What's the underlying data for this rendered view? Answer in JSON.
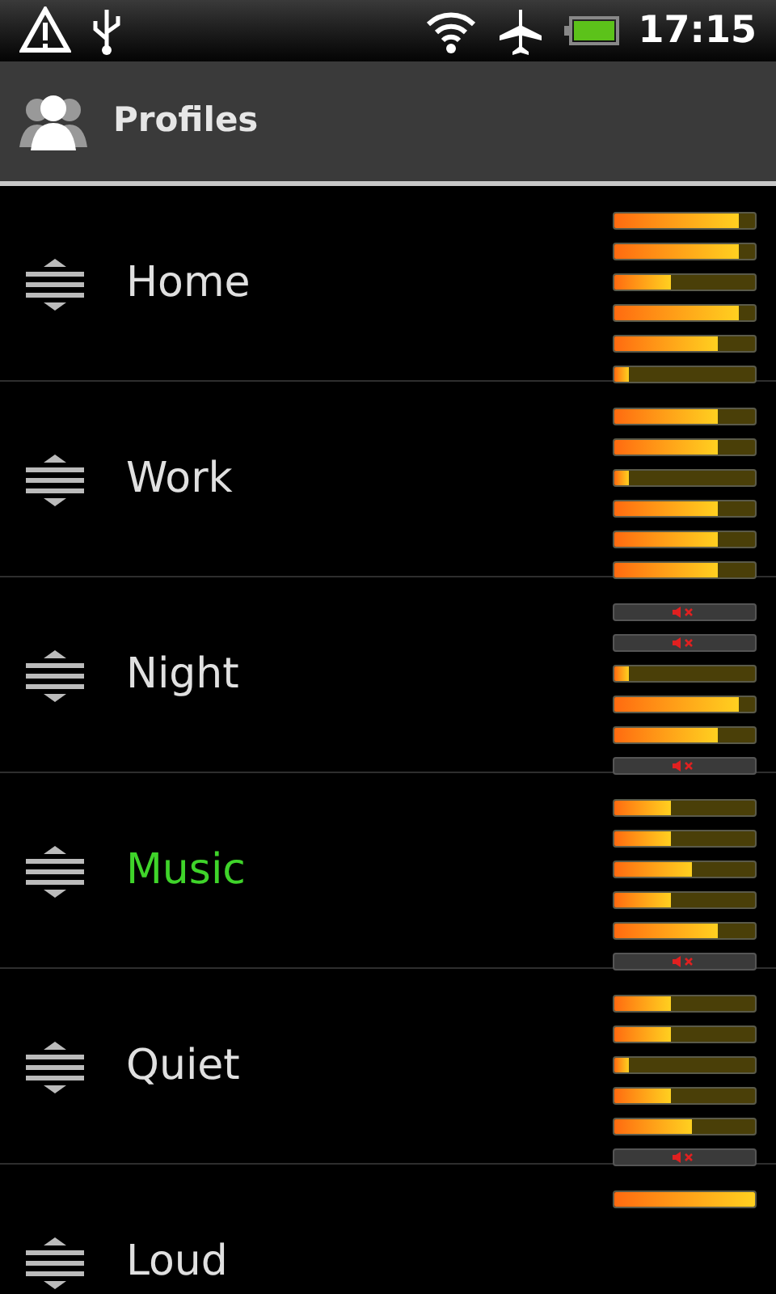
{
  "status_bar": {
    "time": "17:15"
  },
  "header": {
    "title": "Profiles"
  },
  "profiles": [
    {
      "name": "Home",
      "selected": false,
      "meters": [
        {
          "kind": "level",
          "level": 0.88
        },
        {
          "kind": "level",
          "level": 0.88
        },
        {
          "kind": "level",
          "level": 0.4
        },
        {
          "kind": "level",
          "level": 0.88
        },
        {
          "kind": "level",
          "level": 0.73
        },
        {
          "kind": "level",
          "level": 0.1
        }
      ]
    },
    {
      "name": "Work",
      "selected": false,
      "meters": [
        {
          "kind": "level",
          "level": 0.73
        },
        {
          "kind": "level",
          "level": 0.73
        },
        {
          "kind": "level",
          "level": 0.1
        },
        {
          "kind": "level",
          "level": 0.73
        },
        {
          "kind": "level",
          "level": 0.73
        },
        {
          "kind": "level",
          "level": 0.73
        }
      ]
    },
    {
      "name": "Night",
      "selected": false,
      "meters": [
        {
          "kind": "muted"
        },
        {
          "kind": "muted"
        },
        {
          "kind": "level",
          "level": 0.1
        },
        {
          "kind": "level",
          "level": 0.88
        },
        {
          "kind": "level",
          "level": 0.73
        },
        {
          "kind": "muted"
        }
      ]
    },
    {
      "name": "Music",
      "selected": true,
      "meters": [
        {
          "kind": "level",
          "level": 0.4
        },
        {
          "kind": "level",
          "level": 0.4
        },
        {
          "kind": "level",
          "level": 0.55
        },
        {
          "kind": "level",
          "level": 0.4
        },
        {
          "kind": "level",
          "level": 0.73
        },
        {
          "kind": "muted"
        }
      ]
    },
    {
      "name": "Quiet",
      "selected": false,
      "meters": [
        {
          "kind": "level",
          "level": 0.4
        },
        {
          "kind": "level",
          "level": 0.4
        },
        {
          "kind": "level",
          "level": 0.1
        },
        {
          "kind": "level",
          "level": 0.4
        },
        {
          "kind": "level",
          "level": 0.55
        },
        {
          "kind": "muted"
        }
      ]
    },
    {
      "name": "Loud",
      "selected": false,
      "meters": [
        {
          "kind": "level",
          "level": 1.0
        }
      ]
    }
  ]
}
